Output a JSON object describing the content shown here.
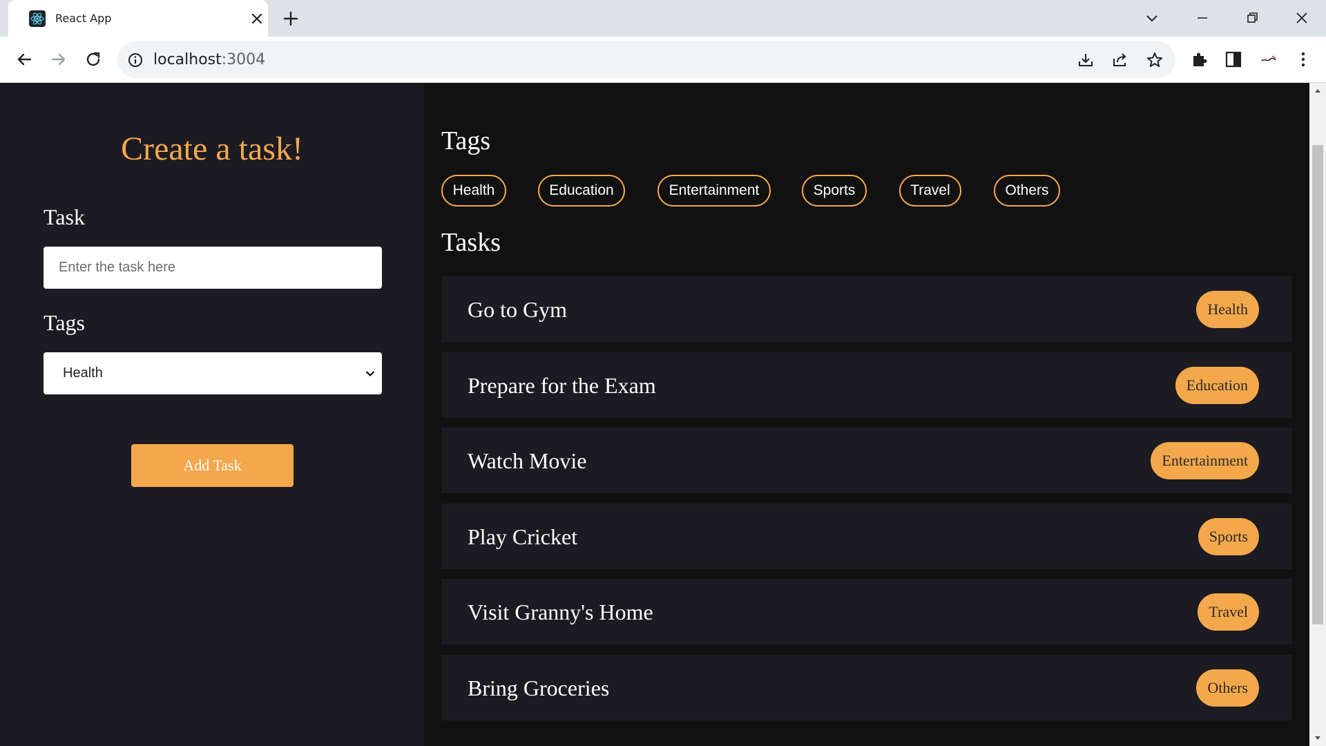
{
  "browser": {
    "tab_title": "React App",
    "url_host": "localhost",
    "url_port": ":3004"
  },
  "form": {
    "title": "Create a task!",
    "task_label": "Task",
    "task_placeholder": "Enter the task here",
    "task_value": "",
    "tags_label": "Tags",
    "selected_tag": "Health",
    "submit_label": "Add Task"
  },
  "tags_section": {
    "title": "Tags",
    "items": [
      "Health",
      "Education",
      "Entertainment",
      "Sports",
      "Travel",
      "Others"
    ]
  },
  "tasks_section": {
    "title": "Tasks",
    "items": [
      {
        "name": "Go to Gym",
        "tag": "Health"
      },
      {
        "name": "Prepare for the Exam",
        "tag": "Education"
      },
      {
        "name": "Watch Movie",
        "tag": "Entertainment"
      },
      {
        "name": "Play Cricket",
        "tag": "Sports"
      },
      {
        "name": "Visit Granny's Home",
        "tag": "Travel"
      },
      {
        "name": "Bring Groceries",
        "tag": "Others"
      }
    ]
  },
  "colors": {
    "accent": "#f4a84c",
    "panel": "#1c1b22",
    "background": "#111111"
  }
}
